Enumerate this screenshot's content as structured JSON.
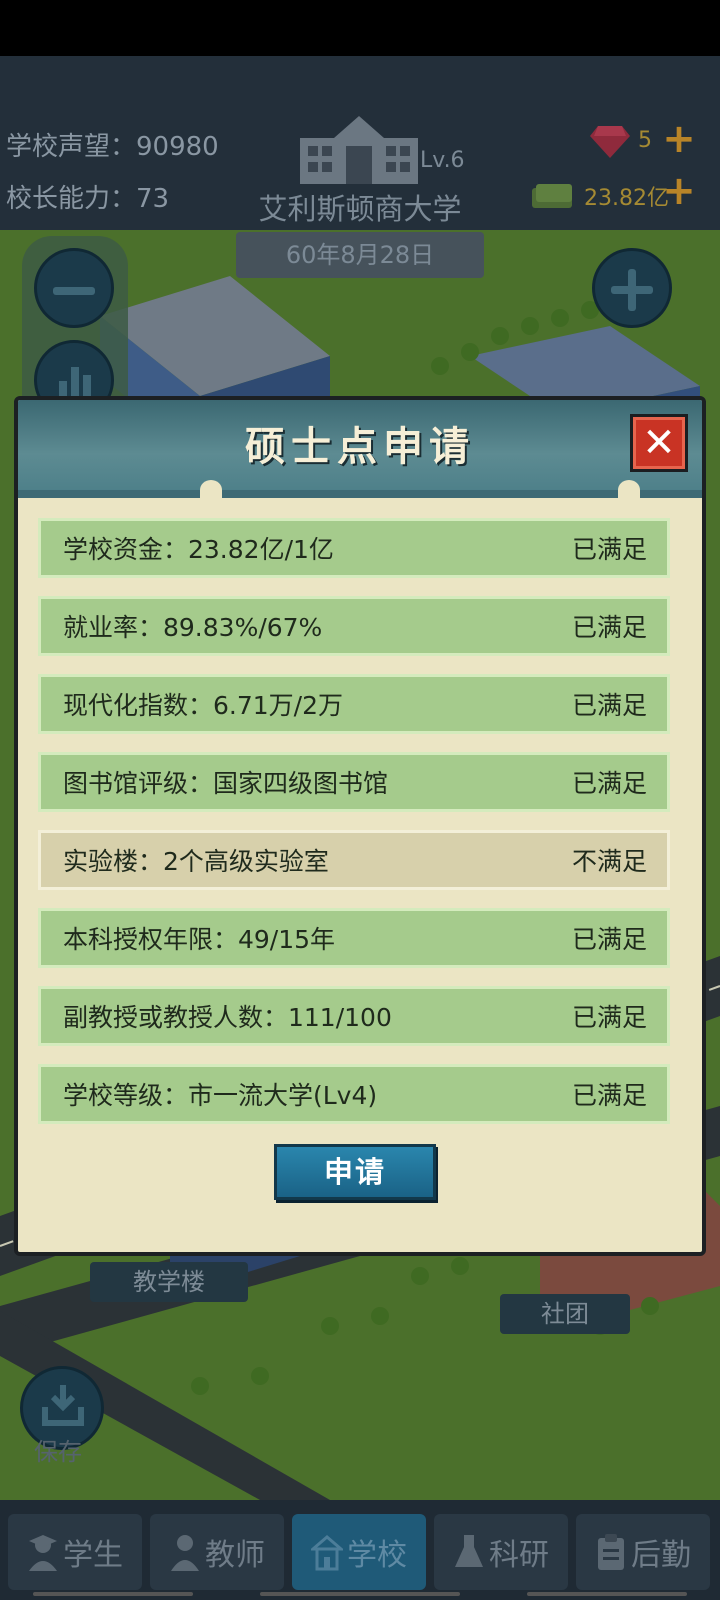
{
  "hud": {
    "reputation_label": "学校声望：",
    "reputation_value": "90980",
    "ability_label": "校长能力：",
    "ability_value": "73",
    "school_name": "艾利斯顿商大学",
    "level": "Lv.6",
    "date": "60年8月28日",
    "gems": "5",
    "money": "23.82亿"
  },
  "map_labels": {
    "teaching_building": "教学楼",
    "club": "社团",
    "save": "保存"
  },
  "modal": {
    "title": "硕士点申请",
    "close_icon": "close-x-icon",
    "requirements": [
      {
        "label": "学校资金：23.82亿/1亿",
        "status": "已满足",
        "met": true
      },
      {
        "label": "就业率：89.83%/67%",
        "status": "已满足",
        "met": true
      },
      {
        "label": "现代化指数：6.71万/2万",
        "status": "已满足",
        "met": true
      },
      {
        "label": "图书馆评级：国家四级图书馆",
        "status": "已满足",
        "met": true
      },
      {
        "label": "实验楼：2个高级实验室",
        "status": "不满足",
        "met": false
      },
      {
        "label": "本科授权年限：49/15年",
        "status": "已满足",
        "met": true
      },
      {
        "label": "副教授或教授人数：111/100",
        "status": "已满足",
        "met": true
      },
      {
        "label": "学校等级：市一流大学(Lv4)",
        "status": "已满足",
        "met": true
      }
    ],
    "apply_label": "申请"
  },
  "nav": {
    "items": [
      {
        "label": "学生",
        "icon": "student-icon"
      },
      {
        "label": "教师",
        "icon": "teacher-icon"
      },
      {
        "label": "学校",
        "icon": "school-icon",
        "active": true
      },
      {
        "label": "科研",
        "icon": "flask-icon"
      },
      {
        "label": "后勤",
        "icon": "clipboard-icon"
      }
    ]
  },
  "colors": {
    "met_row": "#a5cb8c",
    "unmet_row": "#d7d0ab",
    "modal_bg": "#ebe5c4",
    "close_red": "#c93324",
    "apply_blue": "#1f79a0"
  }
}
